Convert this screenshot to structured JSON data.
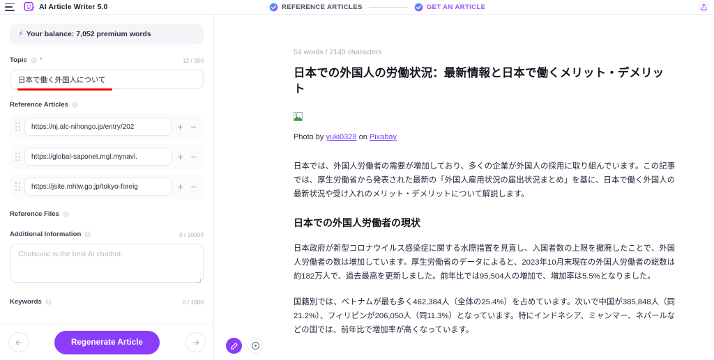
{
  "topbar": {
    "menu_icon": "hamburger-menu-icon",
    "logo_icon": "app-logo-icon",
    "app_title": "AI Article Writer 5.0",
    "share_icon": "share-upload-icon",
    "steps": [
      {
        "label": "REFERENCE ARTICLES",
        "icon": "check-circle-icon",
        "state": "complete"
      },
      {
        "label": "GET AN ARTICLE",
        "icon": "check-circle-icon",
        "state": "active"
      }
    ]
  },
  "sidebar": {
    "balance": {
      "icon": "lightning-bolt-icon",
      "text": "Your balance: 7,052 premium words"
    },
    "topic": {
      "label": "Topic",
      "info_icon": "info-icon",
      "required_marker": "*",
      "counter": "12 / 200",
      "value": "日本で働く外国人について",
      "highlight_color": "#ff0000"
    },
    "reference_articles": {
      "label": "Reference Articles",
      "info_icon": "info-icon",
      "rows": [
        {
          "value": "https://nj.alc-nihongo.jp/entry/202",
          "drag_icon": "drag-handle-icon",
          "add_icon": "plus-icon",
          "remove_icon": "minus-icon"
        },
        {
          "value": "https://global-saponet.mgl.mynavi.",
          "drag_icon": "drag-handle-icon",
          "add_icon": "plus-icon",
          "remove_icon": "minus-icon"
        },
        {
          "value": "https://jsite.mhlw.go.jp/tokyo-foreig",
          "drag_icon": "drag-handle-icon",
          "add_icon": "plus-icon",
          "remove_icon": "minus-icon"
        }
      ]
    },
    "reference_files": {
      "label": "Reference Files",
      "info_icon": "info-icon"
    },
    "additional_information": {
      "label": "Additional Information",
      "info_icon": "info-icon",
      "counter": "0 / 10000",
      "value": "",
      "placeholder": "Chatsonic is the best AI chatbot."
    },
    "keywords": {
      "label": "Keywords",
      "info_icon": "info-icon",
      "counter": "0 / 1000"
    },
    "footer": {
      "back_icon": "arrow-left-icon",
      "forward_icon": "arrow-right-icon",
      "primary_label": "Regenerate Article",
      "primary_color": "#8b3dfb"
    }
  },
  "editor": {
    "meta": "54 words / 2140 characters",
    "title": "日本での外国人の労働状況：最新情報と日本で働くメリット・デメリット",
    "image_placeholder_icon": "broken-image-icon",
    "credit": {
      "prefix": "Photo by ",
      "author": "yuki0328",
      "middle": " on ",
      "source": "Pixabay"
    },
    "paragraph_1": "日本では、外国人労働者の需要が増加しており、多くの企業が外国人の採用に取り組んでいます。この記事では、厚生労働省から発表された最新の「外国人雇用状況の届出状況まとめ」を基に、日本で働く外国人の最新状況や受け入れのメリット・デメリットについて解説します。",
    "heading_2": "日本での外国人労働者の現状",
    "paragraph_2": "日本政府が新型コロナウイルス感染症に関する水際措置を見直し、入国者数の上限を撤廃したことで、外国人労働者の数は増加しています。厚生労働省のデータによると、2023年10月末現在の外国人労働者の総数は約182万人で、過去最高を更新しました。前年比では95,504人の増加で、増加率は5.5%となりました。",
    "paragraph_3": "国籍別では、ベトナムが最も多く462,384人（全体の25.4%）を占めています。次いで中国が385,848人（同21.2%）、フィリピンが206,050人（同11.3%）となっています。特にインドネシア、ミャンマー、ネパールなどの国では、前年比で増加率が高くなっています。",
    "fab_edit_icon": "pencil-edit-icon",
    "fab_play_icon": "play-circle-icon"
  }
}
